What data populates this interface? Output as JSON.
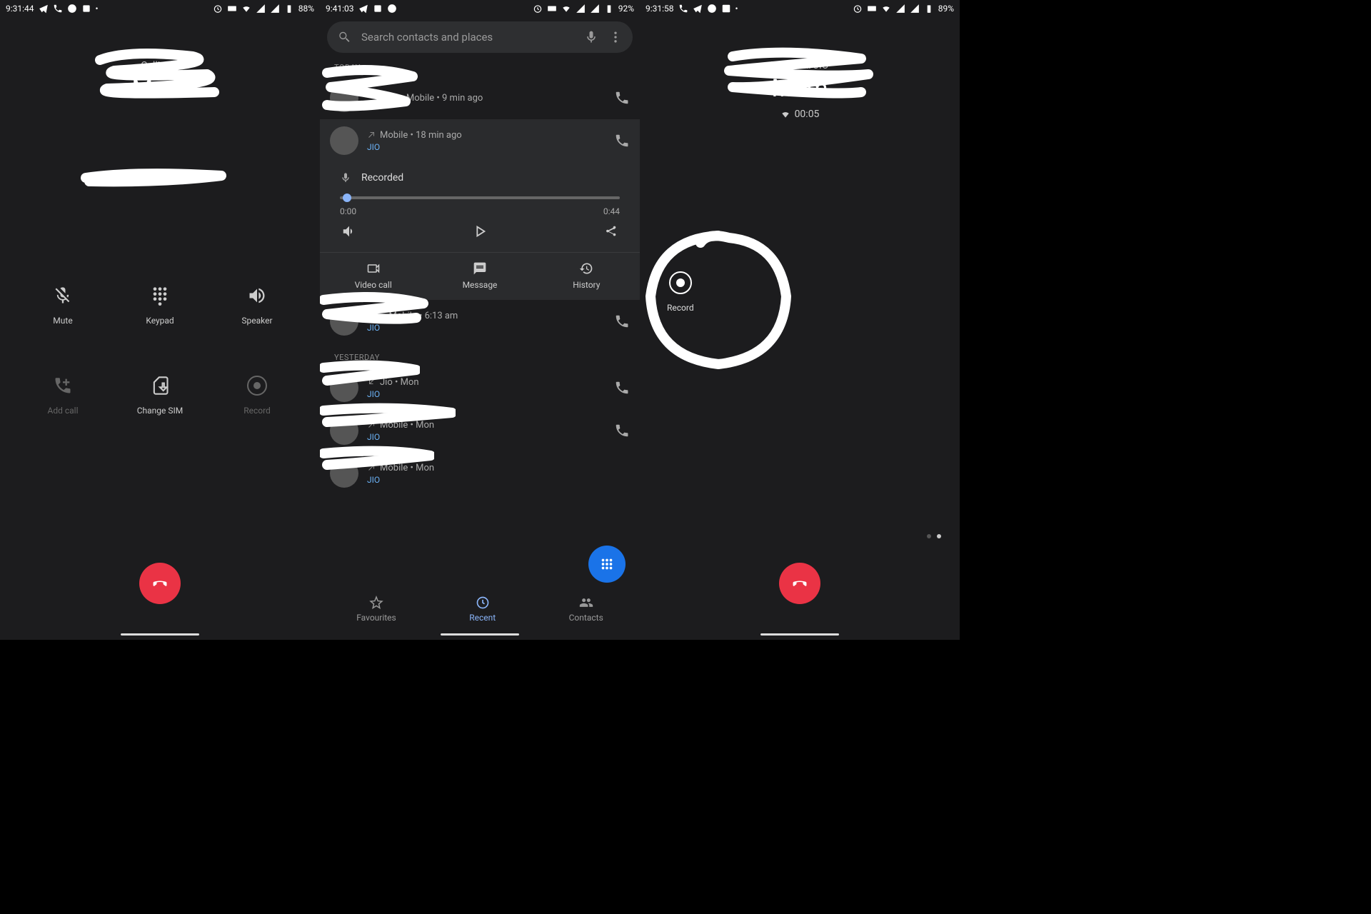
{
  "screen1": {
    "status": {
      "time": "9:31:44",
      "battery": "88%"
    },
    "call_status": "Calling...",
    "call_name": "Mom",
    "buttons": {
      "mute": "Mute",
      "keypad": "Keypad",
      "speaker": "Speaker",
      "add_call": "Add call",
      "change_sim": "Change SIM",
      "record": "Record"
    }
  },
  "screen2": {
    "status": {
      "time": "9:41:03",
      "battery": "92%"
    },
    "search_placeholder": "Search contacts and places",
    "section_today": "TODAY",
    "section_yesterday": "YESTERDAY",
    "rows": [
      {
        "meta": "Mobile • 9 min ago",
        "tag": ""
      },
      {
        "meta": "Mobile • 18 min ago",
        "tag": "JIO",
        "expanded": true
      },
      {
        "meta": "Mobile • 6:13 am",
        "tag": "JIO"
      }
    ],
    "yesterday_rows": [
      {
        "meta": "Jio • Mon",
        "tag": "JIO"
      },
      {
        "meta": "Mobile • Mon",
        "tag": "JIO"
      },
      {
        "meta": "Mobile • Mon",
        "tag": "JIO"
      }
    ],
    "recorded": {
      "label": "Recorded",
      "start": "0:00",
      "end": "0:44"
    },
    "actions": {
      "video": "Video call",
      "message": "Message",
      "history": "History"
    },
    "bottom": {
      "fav": "Favourites",
      "recent": "Recent",
      "contacts": "Contacts"
    }
  },
  "screen3": {
    "status": {
      "time": "9:31:58",
      "battery": "89%"
    },
    "call_status": "Wi-Fi call JIO",
    "call_name": "Mom",
    "call_time": "00:05",
    "record_label": "Record"
  }
}
